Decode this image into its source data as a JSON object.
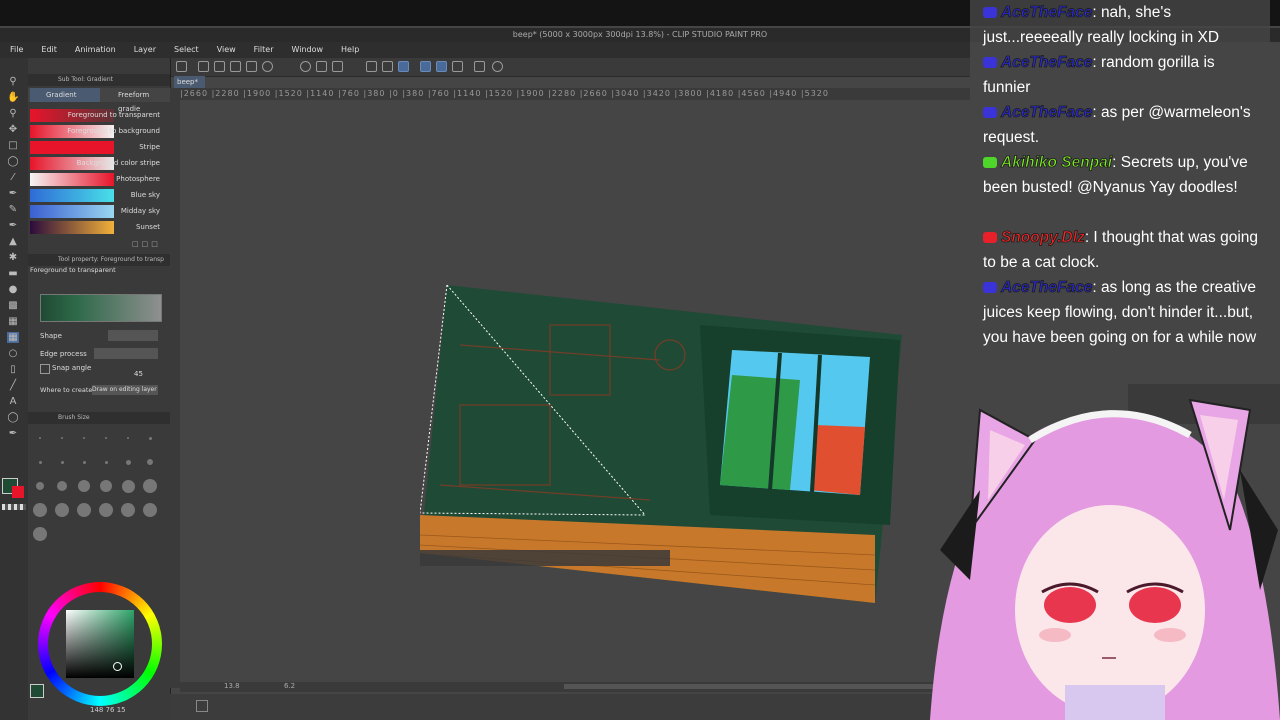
{
  "window": {
    "title": "beep* (5000 x 3000px 300dpi 13.8%) - CLIP STUDIO PAINT PRO"
  },
  "menu": [
    "File",
    "Edit",
    "Animation",
    "Layer",
    "Select",
    "View",
    "Filter",
    "Window",
    "Help"
  ],
  "canvas_tab": "beep*",
  "ruler_marks": "|2660 |2280 |1900 |1520 |1140 |760 |380 |0 |380 |760 |1140 |1520 |1900 |2280 |2660 |3040 |3420 |3800 |4180 |4560 |4940 |5320",
  "subtool": {
    "header": "Sub Tool: Gradient",
    "tabs": [
      "Gradient",
      "Freeform gradie"
    ],
    "presets": [
      {
        "label": "Foreground to transparent",
        "c1": "#e8142a",
        "c2": "rgba(232,20,42,0.2)"
      },
      {
        "label": "Foreground to background",
        "c1": "#e8142a",
        "c2": "#f2f2f2"
      },
      {
        "label": "Stripe",
        "c1": "#e8142a",
        "c2": "#e8142a"
      },
      {
        "label": "Background color stripe",
        "c1": "#e8142a",
        "c2": "#e8e8e8"
      },
      {
        "label": "Photosphere",
        "c1": "#f5f5f5",
        "c2": "#e8142a"
      },
      {
        "label": "Blue sky",
        "c1": "#2f6bd6",
        "c2": "#48e0e8"
      },
      {
        "label": "Midday sky",
        "c1": "#3a5fd0",
        "c2": "#9ad6f0"
      },
      {
        "label": "Sunset",
        "c1": "#2c0b3b",
        "c2": "#f2b13a"
      }
    ]
  },
  "tool_property": {
    "header": "Tool property: Foreground to transp",
    "preset_name": "Foreground to transparent",
    "shape_label": "Shape",
    "edge_label": "Edge process",
    "snap_label": "Snap angle",
    "snap_value": "45",
    "where_label": "Where to create",
    "where_value": "Draw on editing layer"
  },
  "brush_size": {
    "header": "Brush Size"
  },
  "status": {
    "zoom": "13.8",
    "angle": "6.2",
    "color_readout": "148  76  15"
  },
  "chat": [
    {
      "user": "AceTheFace",
      "user_color": "#2a2ad8",
      "badge": "#3a34d8",
      "text": ": nah, she's just...reeeeally really locking in XD"
    },
    {
      "user": "AceTheFace",
      "user_color": "#2a2ad8",
      "badge": "#3a34d8",
      "text": ": random gorilla is funnier"
    },
    {
      "user": "AceTheFace",
      "user_color": "#2a2ad8",
      "badge": "#3a34d8",
      "text": ": as per @warmeleon's request."
    },
    {
      "user": "Akihiko Senpai",
      "user_color": "#7cf022",
      "badge": "#4fd62a",
      "text": ": Secrets up, you've been busted! @Nyanus Yay doodles!"
    },
    {
      "user": "Snoopy.Dlz",
      "user_color": "#ff2424",
      "badge": "#e8202a",
      "text": ": I thought that was going to be a cat clock."
    },
    {
      "user": "AceTheFace",
      "user_color": "#2a2ad8",
      "badge": "#3a34d8",
      "text": ": as long as the creative juices keep flowing, don't hinder it...but, you have been going on for a while now"
    }
  ],
  "colors": {
    "accent_blue": "#2a5a9a",
    "panel_bg": "#3a3a3a",
    "chat_bg": "#464646"
  }
}
